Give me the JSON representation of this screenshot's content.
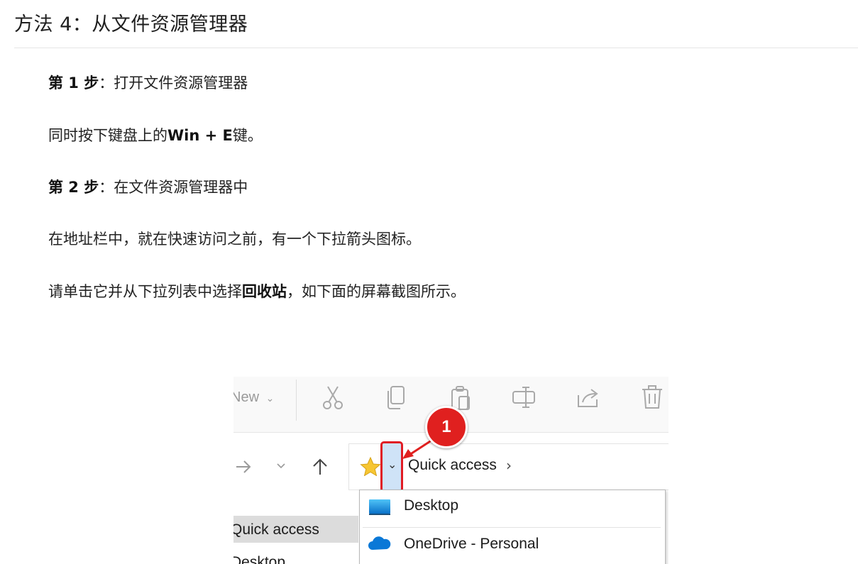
{
  "heading": "方法 4：从文件资源管理器",
  "step1": {
    "bold": "第 1 步",
    "text": "：打开文件资源管理器"
  },
  "p1": {
    "pre": "同时按下键盘上的",
    "bold": "Win + E",
    "post": "键。"
  },
  "step2": {
    "bold": "第 2 步",
    "text": "：在文件资源管理器中"
  },
  "p2": "在地址栏中，就在快速访问之前，有一个下拉箭头图标。",
  "p3": {
    "pre": "请单击它并从下拉列表中选择",
    "bold": "回收站",
    "post": "，如下面的屏幕截图所示。"
  },
  "screenshot": {
    "toolbar": {
      "new_label": "New",
      "icons": [
        "cut-icon",
        "copy-icon",
        "paste-icon",
        "rename-icon",
        "share-icon",
        "delete-icon"
      ]
    },
    "address_bar": {
      "location": "Quick access",
      "separator": "›"
    },
    "callout_number": "1",
    "dropdown_items": [
      {
        "label": "Desktop",
        "icon": "desktop-folder-icon"
      },
      {
        "label": "OneDrive - Personal",
        "icon": "onedrive-cloud-icon"
      }
    ],
    "sidebar_items": [
      "Quick access",
      "Desktop"
    ],
    "accent_color": "#e0201f",
    "highlight_color": "#cfe3f7"
  }
}
